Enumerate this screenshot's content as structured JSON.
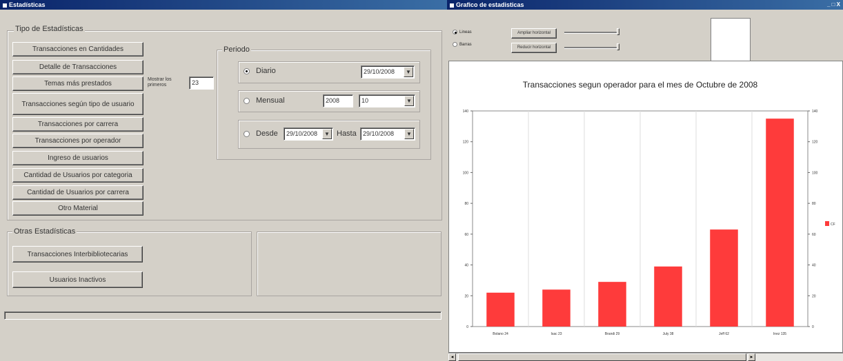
{
  "left_window": {
    "title": "Estadísticas",
    "tipo_group": {
      "label": "Tipo de Estadísticas",
      "buttons": [
        "Transacciones en Cantidades",
        "Detalle de Transacciones",
        "Temas más prestados",
        "Transacciones según tipo de usuario",
        "Transacciones por carrera",
        "Transacciones por operador",
        "Ingreso de usuarios",
        "Cantidad de Usuarios por categoria",
        "Cantidad de Usuarios por carrera",
        "Otro Material"
      ],
      "mostrar_label": "Mostrar los primeros",
      "mostrar_value": "23"
    },
    "periodo": {
      "label": "Periodo",
      "diario_label": "Diario",
      "diario_date": "29/10/2008",
      "mensual_label": "Mensual",
      "mensual_year": "2008",
      "mensual_month": "10",
      "desde_label": "Desde",
      "desde_date": "29/10/2008",
      "hasta_label": "Hasta",
      "hasta_date": "29/10/2008"
    },
    "otras_group": {
      "label": "Otras Estadísticas",
      "buttons": [
        "Transacciones Interbibliotecarias",
        "Usuarios Inactivos"
      ]
    }
  },
  "right_window": {
    "title": "Grafico de estadisticas",
    "radio1_label": "Lineas",
    "radio2_label": "Barras",
    "btn1_label": "Ampliar horizontal",
    "btn2_label": "Reducir horizontal",
    "close_glyphs": "_ □ X"
  },
  "colors": {
    "bar": "#fe3b3b",
    "title_bar": "#0a246a"
  },
  "chart_data": {
    "type": "bar",
    "title": "Transacciones segun operador para el mes de Octubre de 2008",
    "categories": [
      "Bolano 24",
      "Isac 23",
      "Brandi 29",
      "July 38",
      "Jeff 62",
      "Inez 135"
    ],
    "values": [
      22,
      24,
      29,
      39,
      63,
      135
    ],
    "ylim": [
      0,
      140
    ],
    "yticks": [
      0,
      20,
      40,
      60,
      80,
      100,
      120,
      140
    ],
    "legend": [
      "CF"
    ],
    "legend_position": "right",
    "grid": true
  }
}
